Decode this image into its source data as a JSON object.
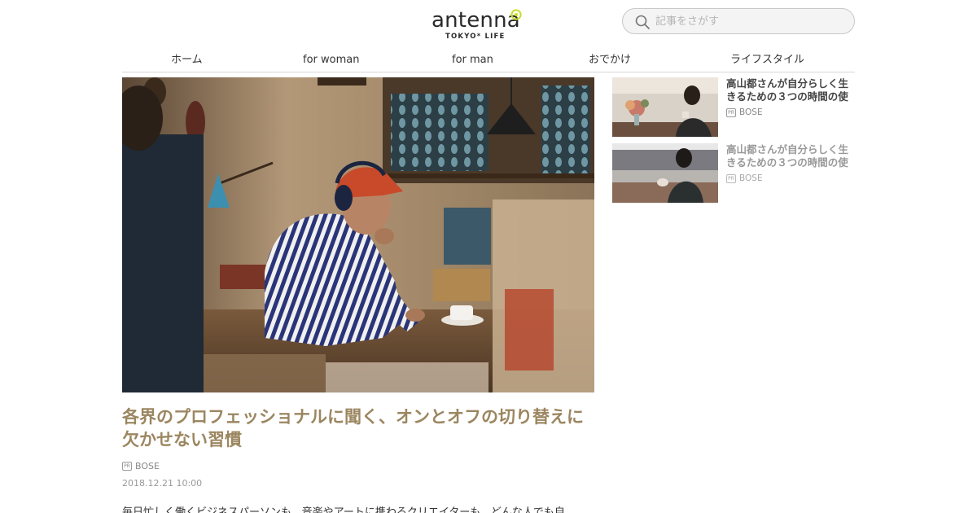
{
  "header": {
    "logo_word": "antenna",
    "logo_sub": "TOKYO* LIFE",
    "search_placeholder": "記事をさがす"
  },
  "nav": {
    "items": [
      "ホーム",
      "for woman",
      "for man",
      "おでかけ",
      "ライフスタイル"
    ]
  },
  "article": {
    "title": "各界のプロフェッショナルに聞く、オンとオフの切り替えに欠かせない習慣",
    "pr_label": "PR",
    "sponsor": "BOSE",
    "date": "2018.12.21 10:00",
    "lead": "毎日忙しく働くビジネスパーソンも、音楽やアートに携わるクリエイターも、どんな人でも自"
  },
  "sidebar": {
    "items": [
      {
        "title": "高山都さんが自分らしく生きるための３つの時間の使",
        "pr_label": "PR",
        "sponsor": "BOSE"
      },
      {
        "title": "高山都さんが自分らしく生きるための３つの時間の使",
        "pr_label": "PR",
        "sponsor": "BOSE"
      }
    ]
  },
  "colors": {
    "title_accent": "#9b8660",
    "logo_mark": "#c8dc28"
  }
}
